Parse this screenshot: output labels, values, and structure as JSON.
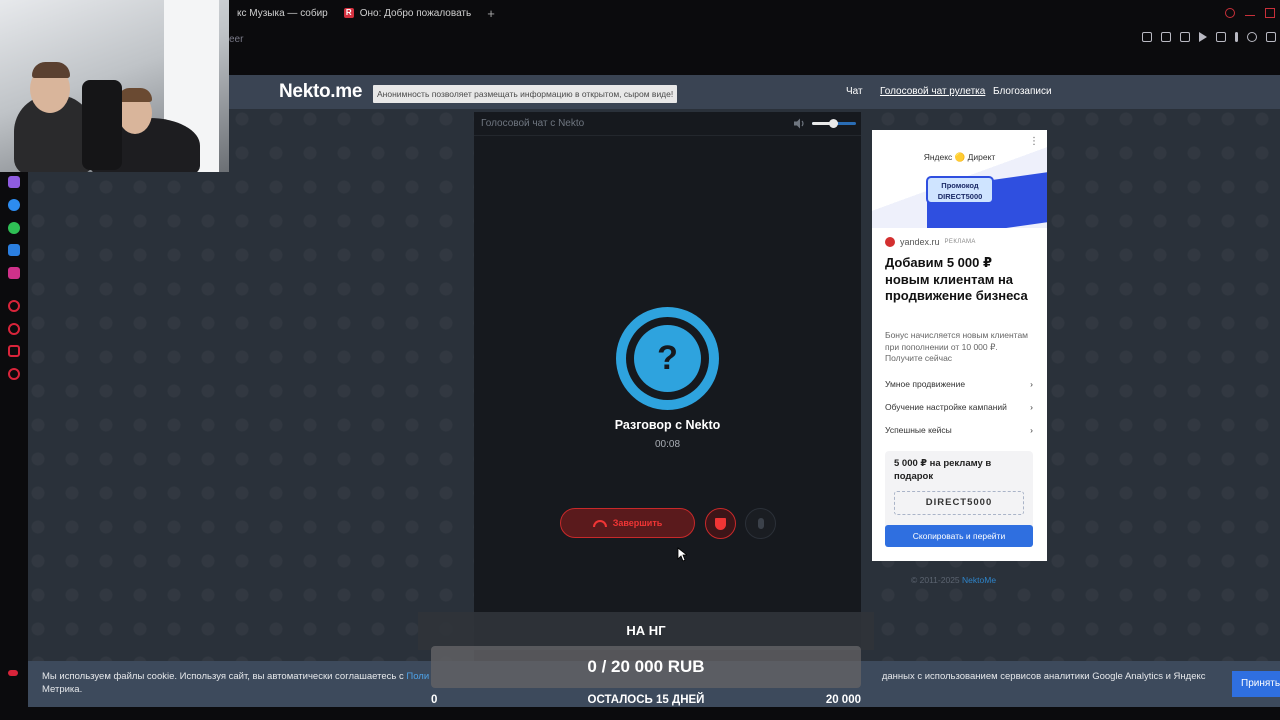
{
  "browser": {
    "tabs": [
      {
        "label": "кс Музыка — собир",
        "favicon": "music-icon"
      },
      {
        "label": "Оно: Добро пожаловать",
        "favicon": "r-icon"
      }
    ],
    "new_tab": "+",
    "address_fragment": "eer"
  },
  "site": {
    "logo": "Nekto.me",
    "slogan": "Анонимность позволяет размещать информацию в открытом, сыром виде!",
    "nav": [
      {
        "label": "Чат"
      },
      {
        "label": "Голосовой чат рулетка",
        "active": true
      },
      {
        "label": "Блогозаписи"
      }
    ]
  },
  "chat": {
    "panel_title": "Голосовой чат с Nekto",
    "volume_fraction": 0.6,
    "avatar_symbol": "?",
    "talk_title": "Разговор с Nekto",
    "timer": "00:08",
    "end_button": "Завершить"
  },
  "ad": {
    "brand": "Яндекс 🟡 Директ",
    "promo_line1": "Промокод",
    "promo_line2": "DIRECT5000",
    "domain": "yandex.ru",
    "domain_tag": "РЕКЛАМА",
    "headline": "Добавим 5 000 ₽ новым клиентам на продвижение бизнеса",
    "description": "Бонус начисляется новым клиентам при пополнении от 10 000 ₽. Получите сейчас",
    "links": [
      "Умное продвижение",
      "Обучение настройке кампаний",
      "Успешные кейсы"
    ],
    "box_text": "5 000 ₽ на рекламу в подарок",
    "code": "DIRECT5000",
    "button": "Скопировать и перейти",
    "chevron": "›",
    "menu": "⋮"
  },
  "footer": {
    "copyright_prefix": "© 2011-2025",
    "copyright_link": "NektoMe"
  },
  "cookie": {
    "text_before": "Мы используем файлы cookie. Используя сайт, вы автоматически соглашаетесь с",
    "link": "Поли",
    "text_after": "данных с использованием сервисов аналитики Google Analytics и Яндекс Метрика.",
    "accept": "Принять"
  },
  "donation": {
    "title": "НА НГ",
    "amount": "0 / 20 000 RUB",
    "min": "0",
    "remaining": "ОСТАЛОСЬ 15 ДНЕЙ",
    "max": "20 000",
    "progress_fraction": 0
  },
  "colors": {
    "accent_blue": "#2ea3de",
    "end_red": "#f03535",
    "header_bg": "#3a4453"
  }
}
